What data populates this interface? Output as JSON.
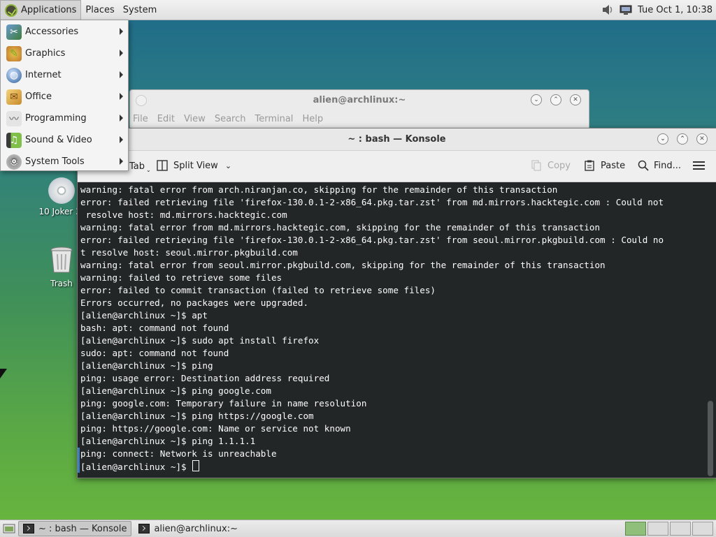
{
  "top_panel": {
    "menus": [
      "Applications",
      "Places",
      "System"
    ],
    "clock": "Tue Oct  1, 10:38",
    "tray_icons": [
      "volume-icon",
      "network-icon"
    ]
  },
  "app_menu": {
    "items": [
      {
        "label": "Accessories",
        "icon": "accessories-icon"
      },
      {
        "label": "Graphics",
        "icon": "graphics-icon"
      },
      {
        "label": "Internet",
        "icon": "internet-icon"
      },
      {
        "label": "Office",
        "icon": "office-icon"
      },
      {
        "label": "Programming",
        "icon": "programming-icon"
      },
      {
        "label": "Sound & Video",
        "icon": "sound-video-icon"
      },
      {
        "label": "System Tools",
        "icon": "system-tools-icon"
      }
    ]
  },
  "desktop": {
    "icons": [
      {
        "label": "10 Joker 2(",
        "icon": "disc-icon"
      },
      {
        "label": "Trash",
        "icon": "trash-icon"
      }
    ]
  },
  "back_window": {
    "title": "alien@archlinux:~",
    "menu": [
      "File",
      "Edit",
      "View",
      "Search",
      "Terminal",
      "Help"
    ]
  },
  "konsole": {
    "title": "~ : bash — Konsole",
    "toolbar": {
      "new_tab": "Tab",
      "split_view": "Split View",
      "copy": "Copy",
      "paste": "Paste",
      "find": "Find..."
    },
    "lines": [
      "warning: fatal error from arch.niranjan.co, skipping for the remainder of this transaction",
      "error: failed retrieving file 'firefox-130.0.1-2-x86_64.pkg.tar.zst' from md.mirrors.hacktegic.com : Could not",
      " resolve host: md.mirrors.hacktegic.com",
      "warning: fatal error from md.mirrors.hacktegic.com, skipping for the remainder of this transaction",
      "error: failed retrieving file 'firefox-130.0.1-2-x86_64.pkg.tar.zst' from seoul.mirror.pkgbuild.com : Could no",
      "t resolve host: seoul.mirror.pkgbuild.com",
      "warning: fatal error from seoul.mirror.pkgbuild.com, skipping for the remainder of this transaction",
      "warning: failed to retrieve some files",
      "error: failed to commit transaction (failed to retrieve some files)",
      "Errors occurred, no packages were upgraded.",
      "[alien@archlinux ~]$ apt",
      "bash: apt: command not found",
      "[alien@archlinux ~]$ sudo apt install firefox",
      "sudo: apt: command not found",
      "[alien@archlinux ~]$ ping",
      "ping: usage error: Destination address required",
      "[alien@archlinux ~]$ ping google.com",
      "ping: google.com: Temporary failure in name resolution",
      "[alien@archlinux ~]$ ping https://google.com",
      "ping: https://google.com: Name or service not known",
      "[alien@archlinux ~]$ ping 1.1.1.1",
      "ping: connect: Network is unreachable"
    ],
    "prompt": "[alien@archlinux ~]$ "
  },
  "taskbar": {
    "tasks": [
      {
        "label": "~ : bash — Konsole",
        "active": true
      },
      {
        "label": "alien@archlinux:~",
        "active": false
      }
    ],
    "workspaces": 4
  },
  "colors": {
    "terminal_bg": "#232627",
    "terminal_fg": "#fcfcfc",
    "accent": "#3d7ebd"
  }
}
